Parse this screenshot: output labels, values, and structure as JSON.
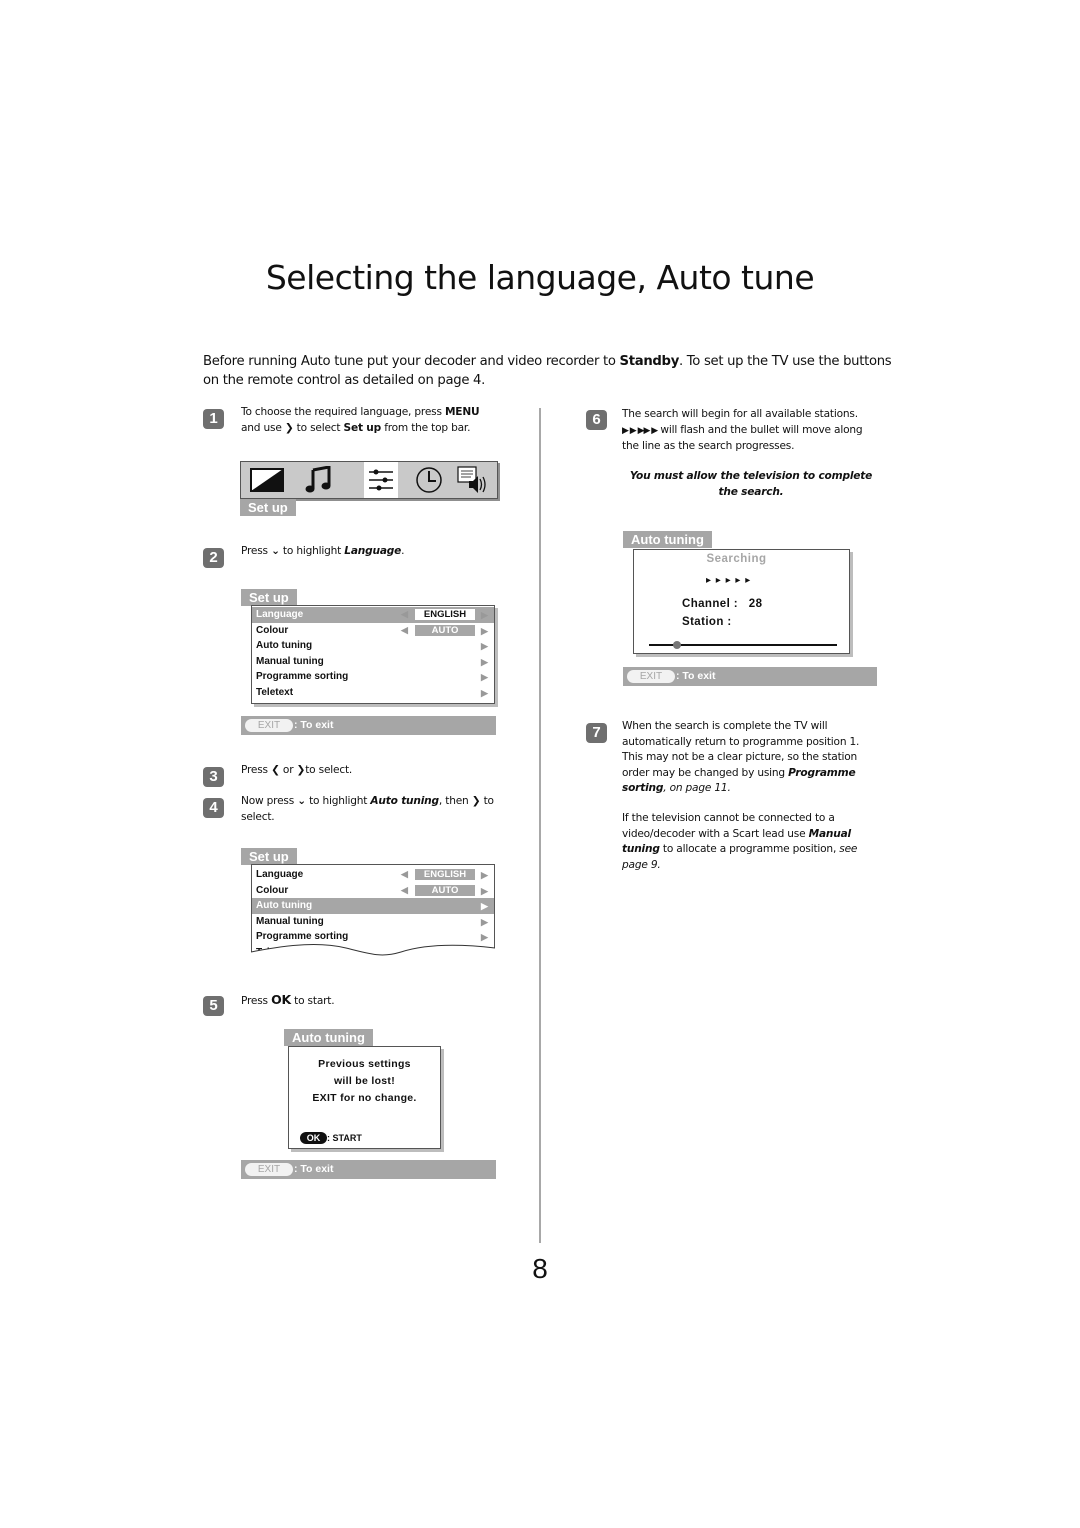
{
  "page": {
    "title": "Selecting the language, Auto tune",
    "page_number": "8"
  },
  "intro": {
    "part1": "Before running Auto tune put your decoder and video recorder to ",
    "bold": "Standby",
    "part2": ". To set up the TV use the buttons on the remote control as detailed on page 4."
  },
  "steps": {
    "s1": {
      "num": "1",
      "t1": "To choose the required language, press ",
      "b1": "MENU",
      "t2": " and use ",
      "arrow": "❯",
      "t3": " to select ",
      "b2": "Set up",
      "t4": " from the top bar."
    },
    "s2": {
      "num": "2",
      "t1": "Press ",
      "arrow": "⌄",
      "t2": " to highlight ",
      "bi": "Language",
      "t3": "."
    },
    "s3": {
      "num": "3",
      "t1": "Press ",
      "a1": "❮",
      "t2": " or ",
      "a2": "❯",
      "t3": "to select."
    },
    "s4": {
      "num": "4",
      "t1": "Now press ",
      "arrow": "⌄",
      "t2": " to highlight ",
      "bi": "Auto tuning",
      "t3": ", then ",
      "a2": "❯",
      "t4": " to select."
    },
    "s5": {
      "num": "5",
      "t1": "Press ",
      "b": "OK",
      "t2": " to start."
    },
    "s6": {
      "num": "6",
      "t1": "The search will begin for all available stations.",
      "t2": " will flash and the bullet will move along the line as the search progresses.",
      "note": "You must allow the television to complete the search."
    },
    "s7": {
      "num": "7",
      "p1a": "When the search is complete the TV will automatically return to programme position 1. This may not be a clear picture, so the station order may be changed by using ",
      "p1b": "Programme sorting",
      "p1c": ", on page 11.",
      "p2a": "If the television cannot be connected to a video/decoder with a Scart lead use ",
      "p2b": "Manual tuning",
      "p2c": " to allocate a programme position, ",
      "p2d": "see page 9."
    }
  },
  "topbar": {
    "icons": [
      "picture-icon",
      "sound-icon",
      "setup-icon",
      "clock-icon",
      "teletext-sound-icon"
    ],
    "selected": "setup-icon",
    "label": "Set up"
  },
  "menu1": {
    "title": "Set up",
    "rows": [
      {
        "label": "Language",
        "value": "ENGLISH",
        "highlighted": true
      },
      {
        "label": "Colour",
        "value": "AUTO"
      },
      {
        "label": "Auto tuning"
      },
      {
        "label": "Manual tuning"
      },
      {
        "label": "Programme sorting"
      },
      {
        "label": "Teletext"
      }
    ]
  },
  "menu2": {
    "title": "Set up",
    "rows": [
      {
        "label": "Language",
        "value": "ENGLISH"
      },
      {
        "label": "Colour",
        "value": "AUTO"
      },
      {
        "label": "Auto tuning",
        "highlighted": true
      },
      {
        "label": "Manual tuning"
      },
      {
        "label": "Programme sorting"
      },
      {
        "label": "Teletext"
      }
    ]
  },
  "warning_box": {
    "title": "Auto tuning",
    "line1": "Previous settings",
    "line2": "will be lost!",
    "line3": "EXIT for no change.",
    "ok_key": "OK",
    "ok_action": ": START"
  },
  "search_box": {
    "title": "Auto tuning",
    "status": "Searching",
    "arrows": "▸ ▸ ▸ ▸ ▸",
    "channel_label": "Channel :",
    "channel_value": "28",
    "station_label": "Station  :",
    "progress": 0.15
  },
  "exit": {
    "key": "EXIT",
    "action": ": To exit"
  },
  "colors": {
    "osd_grey": "#a6a6a6",
    "badge_grey": "#6f6f6f"
  }
}
